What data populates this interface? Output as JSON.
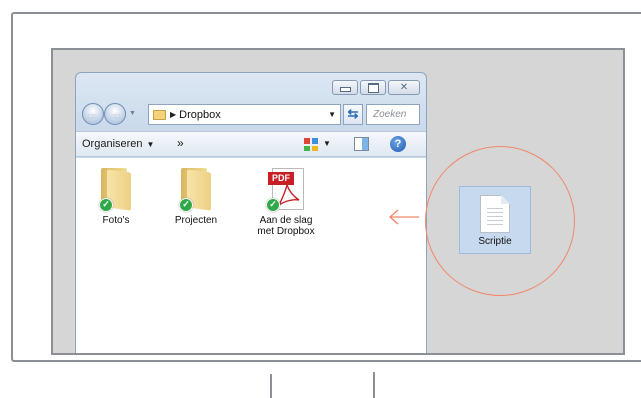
{
  "explorer": {
    "address": {
      "location": "Dropbox",
      "folder_icon": "folder-icon"
    },
    "search": {
      "placeholder": "Zoeken"
    },
    "toolbar": {
      "organize_label": "Organiseren",
      "more_label": "»"
    },
    "files": [
      {
        "name": "Foto's",
        "type": "folder",
        "synced": true
      },
      {
        "name": "Projecten",
        "type": "folder",
        "synced": true
      },
      {
        "name": "Aan de slag met Dropbox",
        "type": "pdf",
        "synced": true,
        "badge": "PDF"
      }
    ]
  },
  "desktop": {
    "file": {
      "name": "Scriptie",
      "type": "document"
    }
  },
  "colors": {
    "sync_check": "#2fa84a",
    "highlight": "#f08769",
    "selection": "#c7d9ee",
    "pdf_tag": "#c81f25"
  }
}
